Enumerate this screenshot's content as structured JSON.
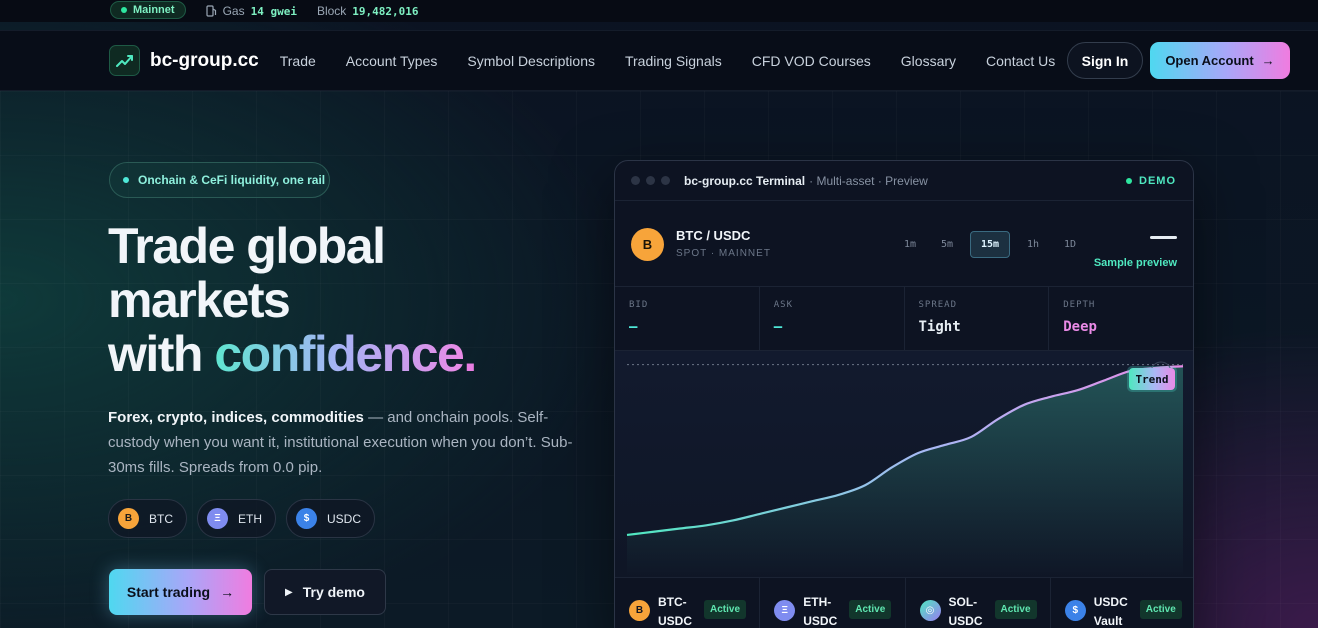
{
  "topstrip": {
    "network": "Mainnet",
    "gas_label": "Gas",
    "gas_value": "14 gwei",
    "block_label": "Block",
    "block_value": "19,482,016"
  },
  "navbar": {
    "brand": "bc-group.cc",
    "links": [
      "Trade",
      "Account Types",
      "Symbol Descriptions",
      "Trading Signals",
      "CFD VOD Courses",
      "Glossary",
      "Contact Us"
    ],
    "sign_in": "Sign In",
    "open_account": "Open Account",
    "arrow": "→"
  },
  "hero": {
    "badge": "Onchain & CeFi liquidity, one rail",
    "headline_line1": "Trade global",
    "headline_line2": "markets",
    "headline_line3_plain": "with ",
    "headline_line3_accent": "confidence",
    "headline_dot": ".",
    "subcopy_bold": "Forex, crypto, indices, commodities",
    "subcopy_rest": " — and onchain pools. Self-custody when you want it, institutional execution when you don’t. Sub-30ms fills. Spreads from 0.0 pip.",
    "chips": [
      {
        "symbol": "B",
        "label": "BTC",
        "color": "#f7a43a"
      },
      {
        "symbol": "Ξ",
        "label": "ETH",
        "color": "#7f8cf0"
      },
      {
        "symbol": "$",
        "label": "USDC",
        "color": "#3b82e8"
      }
    ],
    "cta_primary": "Start trading",
    "cta_primary_arrow": "→",
    "cta_secondary": "Try demo",
    "cta_secondary_icon": "▶"
  },
  "terminal": {
    "title_bold": "bc-group.cc Terminal",
    "title_rest": " · Multi-asset · Preview",
    "demo": "DEMO",
    "pair": "BTC / USDC",
    "pair_symbol": "B",
    "pair_sub": "SPOT · MAINNET",
    "timeframes": [
      "1m",
      "5m",
      "15m",
      "1h",
      "1D"
    ],
    "active_timeframe": "15m",
    "sample_preview": "Sample preview",
    "stats": [
      {
        "label": "BID",
        "value": "—",
        "tone": "teal"
      },
      {
        "label": "ASK",
        "value": "—",
        "tone": "teal"
      },
      {
        "label": "SPREAD",
        "value": "Tight",
        "tone": "white"
      },
      {
        "label": "DEPTH",
        "value": "Deep",
        "tone": "pink"
      }
    ],
    "trend_label": "Trend",
    "assets": [
      {
        "symbol": "B",
        "name": "BTC-USDC",
        "status": "Active",
        "color": "#f7a43a"
      },
      {
        "symbol": "Ξ",
        "name": "ETH-USDC",
        "status": "Active",
        "color": "#7f8cf0"
      },
      {
        "symbol": "◎",
        "name": "SOL-USDC",
        "status": "Active",
        "color": "#9a7cf0"
      },
      {
        "symbol": "$",
        "name": "USDC Vault",
        "status": "Active",
        "color": "#3b82e8"
      }
    ]
  },
  "chart_data": {
    "type": "area",
    "title": "",
    "xlabel": "",
    "ylabel": "",
    "values": [
      10,
      12,
      14,
      16,
      19,
      23,
      27,
      31,
      35,
      41,
      52,
      61,
      66,
      71,
      82,
      91,
      96,
      100,
      106,
      112,
      114,
      115
    ],
    "reference_line": 116,
    "ylim": [
      0,
      122
    ],
    "grid": false,
    "stroke_gradient": [
      "#4fe8c0",
      "#a9b8f5",
      "#e98ae6"
    ]
  }
}
